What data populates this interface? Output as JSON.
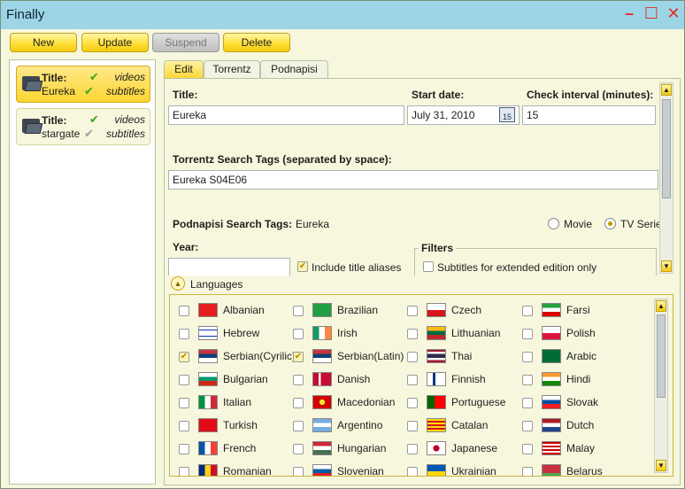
{
  "window": {
    "title": "Finally"
  },
  "toolbar": {
    "new": "New",
    "update": "Update",
    "suspend": "Suspend",
    "delete": "Delete"
  },
  "series": [
    {
      "title_label": "Title:",
      "name": "Eureka",
      "videos": "videos",
      "subtitles": "subtitles",
      "selected": true
    },
    {
      "title_label": "Title:",
      "name": "stargate",
      "videos": "videos",
      "subtitles": "subtitles",
      "selected": false
    }
  ],
  "tabs": [
    "Edit",
    "Torrentz",
    "Podnapisi"
  ],
  "form": {
    "title_label": "Title:",
    "title_value": "Eureka",
    "start_date_label": "Start date:",
    "start_date_value": "July 31, 2010",
    "calendar_day": "15",
    "check_interval_label": "Check interval (minutes):",
    "check_interval_value": "15",
    "torrentz_label": "Torrentz Search Tags (separated by space):",
    "torrentz_value": "Eureka S04E06",
    "podnapisi_label": "Podnapisi Search Tags:",
    "podnapisi_value": "Eureka",
    "movie_label": "Movie",
    "tv_series_label": "TV Serie",
    "year_label": "Year:",
    "year_value": "",
    "include_aliases_label": "Include title aliases",
    "filters_label": "Filters",
    "extended_label": "Subtitles for extended edition only",
    "languages_label": "Languages"
  },
  "languages": [
    {
      "name": "Albanian",
      "checked": false
    },
    {
      "name": "Brazilian",
      "checked": false
    },
    {
      "name": "Czech",
      "checked": false
    },
    {
      "name": "Farsi",
      "checked": false
    },
    {
      "name": "Hebrew",
      "checked": false
    },
    {
      "name": "Irish",
      "checked": false
    },
    {
      "name": "Lithuanian",
      "checked": false
    },
    {
      "name": "Polish",
      "checked": false
    },
    {
      "name": "Serbian(Cyrilic)",
      "checked": true
    },
    {
      "name": "Serbian(Latin)",
      "checked": true
    },
    {
      "name": "Thai",
      "checked": false
    },
    {
      "name": "Arabic",
      "checked": false
    },
    {
      "name": "Bulgarian",
      "checked": false
    },
    {
      "name": "Danish",
      "checked": false
    },
    {
      "name": "Finnish",
      "checked": false
    },
    {
      "name": "Hindi",
      "checked": false
    },
    {
      "name": "Italian",
      "checked": false
    },
    {
      "name": "Macedonian",
      "checked": false
    },
    {
      "name": "Portuguese",
      "checked": false
    },
    {
      "name": "Slovak",
      "checked": false
    },
    {
      "name": "Turkish",
      "checked": false
    },
    {
      "name": "Argentino",
      "checked": false
    },
    {
      "name": "Catalan",
      "checked": false
    },
    {
      "name": "Dutch",
      "checked": false
    },
    {
      "name": "French",
      "checked": false
    },
    {
      "name": "Hungarian",
      "checked": false
    },
    {
      "name": "Japanese",
      "checked": false
    },
    {
      "name": "Malay",
      "checked": false
    },
    {
      "name": "Romanian",
      "checked": false
    },
    {
      "name": "Slovenian",
      "checked": false
    },
    {
      "name": "Ukrainian",
      "checked": false
    },
    {
      "name": "Belarus",
      "checked": false
    }
  ],
  "icons": {
    "folder": "folder-icon",
    "check": "checkmark-icon",
    "calendar": "calendar-icon",
    "expander": "chevron-up-icon",
    "scroll_up": "scroll-up-arrow-icon",
    "scroll_down": "scroll-down-arrow-icon",
    "minimize": "minimize-icon",
    "maximize": "maximize-icon",
    "close": "close-icon"
  },
  "colors": {
    "titlebar": "#9cd6e6",
    "accent": "#fbd630",
    "window_controls": "#e22b2b",
    "check_green": "#3aa820"
  }
}
